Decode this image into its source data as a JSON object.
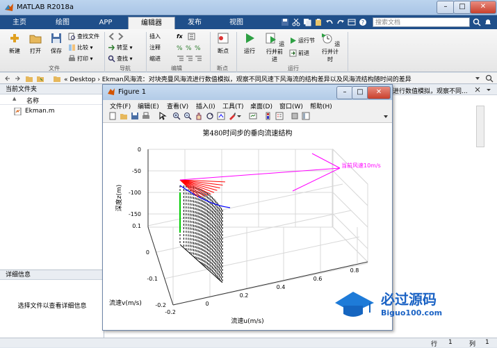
{
  "window": {
    "title": "MATLAB R2018a",
    "minimize": "–",
    "maximize": "□",
    "close": "✕"
  },
  "tabs": [
    {
      "label": "主页"
    },
    {
      "label": "绘图"
    },
    {
      "label": "APP"
    },
    {
      "label": "编辑器"
    },
    {
      "label": "发布"
    },
    {
      "label": "视图"
    }
  ],
  "search": {
    "placeholder": "搜索文档"
  },
  "ribbon": {
    "new": "新建",
    "open": "打开",
    "save": "保存",
    "find_files": "查找文件",
    "compare": "比较",
    "print": "打印",
    "insert": "插入",
    "fx": "fx",
    "comment": "注释",
    "indent": "缩进",
    "goto": "转至",
    "find": "查找",
    "breakpoint": "断点",
    "run": "运行",
    "run_advance": "运行并前进",
    "run_section": "运行节",
    "advance": "前进",
    "run_time": "运行并计时",
    "groups": {
      "file": "文件",
      "nav": "导航",
      "edit": "编辑",
      "bp": "断点",
      "run": "运行"
    }
  },
  "address": {
    "path": "« Desktop › Ekman风海流：对块壳曼风海流进行数值模拟，观察不同风速下风海流的结构差异以及风海流结构随时间的差异"
  },
  "current_folder": {
    "title": "当前文件夹",
    "column": "名称",
    "sort_indicator": "▲",
    "files": [
      "Ekman.m"
    ]
  },
  "details": {
    "title": "详细信息",
    "hint": "选择文件以查看详细信息"
  },
  "right_header": {
    "text": "进行数值模拟，观察不同..."
  },
  "status": {
    "row_label": "行",
    "row": "1",
    "col_label": "列",
    "col": "1"
  },
  "figure": {
    "title": "Figure 1",
    "menu": [
      "文件(F)",
      "编辑(E)",
      "查看(V)",
      "插入(I)",
      "工具(T)",
      "桌面(D)",
      "窗口(W)",
      "帮助(H)"
    ],
    "plot_title": "第480时间步的垂向流速结构",
    "annotation": "当前风速10m/s"
  },
  "chart_data": {
    "type": "line",
    "title": "第480时间步的垂向流速结构",
    "xlabel": "流速u(m/s)",
    "ylabel": "流速v(m/s)",
    "zlabel": "深度z(m)",
    "xticks": [
      "-0.2",
      "0",
      "0.2",
      "0.4",
      "0.6",
      "0.8"
    ],
    "yticks": [
      "-0.2",
      "-0.1",
      "0",
      "0.1"
    ],
    "zticks": [
      "0",
      "-50",
      "-100",
      "-150"
    ],
    "annotation": "当前风速10m/s",
    "grid": true,
    "colors": {
      "wind": "#ff00ff",
      "surface_vectors": "#ff0000",
      "profile": "#0000ff",
      "axis_line": "#00cc00",
      "depth_lines": "#000000"
    }
  },
  "watermark": {
    "text": "必过源码",
    "url": "Biguo100.com"
  },
  "colors": {
    "accent": "#1f4f8a",
    "tab_active_bg": "#f2f2f2"
  }
}
